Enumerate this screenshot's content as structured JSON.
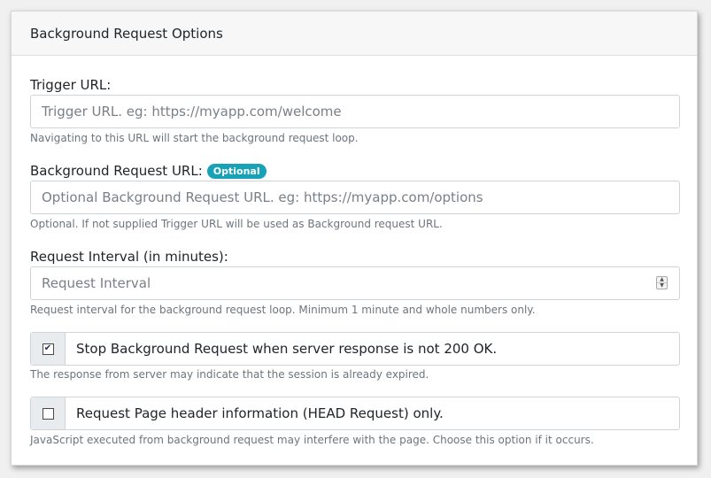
{
  "panel": {
    "title": "Background Request Options"
  },
  "trigger_url": {
    "label": "Trigger URL:",
    "placeholder": "Trigger URL. eg: https://myapp.com/welcome",
    "value": "",
    "help": "Navigating to this URL will start the background request loop."
  },
  "background_url": {
    "label": "Background Request URL:",
    "badge": "Optional",
    "placeholder": "Optional Background Request URL. eg: https://myapp.com/options",
    "value": "",
    "help": "Optional. If not supplied Trigger URL will be used as Background request URL."
  },
  "interval": {
    "label": "Request Interval (in minutes):",
    "placeholder": "Request Interval",
    "value": "",
    "help": "Request interval for the background request loop. Minimum 1 minute and whole numbers only.",
    "spin_up": "▲",
    "spin_down": "▼"
  },
  "stop_on_non_200": {
    "label": "Stop Background Request when server response is not 200 OK.",
    "checked": true,
    "check_glyph": "✔",
    "help": "The response from server may indicate that the session is already expired."
  },
  "head_only": {
    "label": "Request Page header information (HEAD Request) only.",
    "checked": false,
    "check_glyph": "",
    "help": "JavaScript executed from background request may interfere with the page. Choose this option if it occurs."
  },
  "colors": {
    "badge": "#17a2b8",
    "help_text": "#6c757d",
    "border": "#ced4da"
  }
}
